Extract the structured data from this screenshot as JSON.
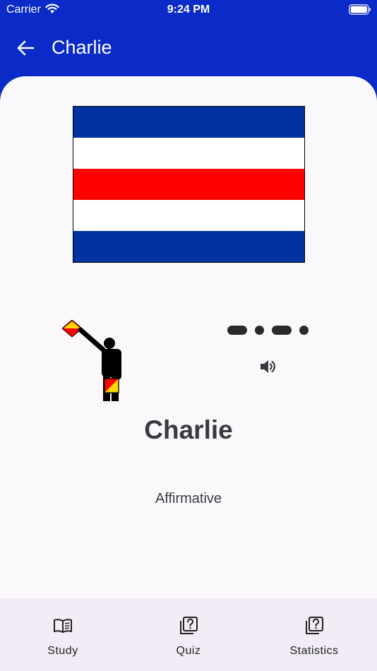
{
  "status_bar": {
    "carrier": "Carrier",
    "time": "9:24 PM"
  },
  "app_bar": {
    "title": "Charlie",
    "back_icon": "arrow-left-icon"
  },
  "flag": {
    "stripes": [
      "#0033a0",
      "#ffffff",
      "#ff0000",
      "#ffffff",
      "#0033a0"
    ]
  },
  "morse": {
    "code": "-.-.",
    "speaker_icon": "speaker-icon"
  },
  "letter": {
    "name": "Charlie",
    "meaning": "Affirmative"
  },
  "bottom_nav": {
    "items": [
      {
        "label": "Study",
        "icon": "open-book-icon"
      },
      {
        "label": "Quiz",
        "icon": "question-card-icon"
      },
      {
        "label": "Statistics",
        "icon": "question-card-icon"
      }
    ]
  },
  "colors": {
    "primary": "#0a2bc8",
    "surface": "#fbf8fb",
    "nav_bg": "#f1ecf5",
    "text": "#3a3a3e"
  }
}
